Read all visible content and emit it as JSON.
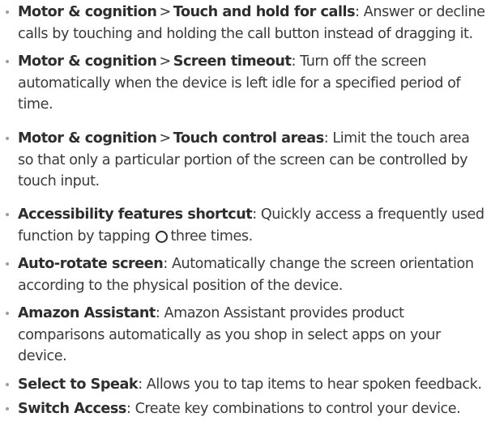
{
  "items": [
    {
      "path": [
        "Motor & cognition",
        "Touch and hold for calls"
      ],
      "desc": ": Answer or decline calls by touching and holding the call button instead of dragging it."
    },
    {
      "path": [
        "Motor & cognition",
        "Screen timeout"
      ],
      "desc": ": Turn off the screen automatically when the device is left idle for a specified period of time."
    },
    {
      "path": [
        "Motor & cognition",
        "Touch control areas"
      ],
      "desc": ": Limit the touch area so that only a particular portion of the screen can be controlled by touch input."
    },
    {
      "title": "Accessibility features shortcut",
      "desc_before_icon": ": Quickly access a frequently used function by tapping",
      "icon": "home-circle-icon",
      "desc_after_icon": "three times."
    },
    {
      "title": "Auto-rotate screen",
      "desc": ": Automatically change the screen orientation according to the physical position of the device."
    },
    {
      "title": "Amazon Assistant",
      "desc": ": Amazon Assistant provides product comparisons automatically as you shop in select apps on your device."
    },
    {
      "title": "Select to Speak",
      "desc": ": Allows you to tap items to hear spoken feedback."
    },
    {
      "title": "Switch Access",
      "desc": ": Create key combinations to control your device."
    }
  ],
  "separator": ">"
}
